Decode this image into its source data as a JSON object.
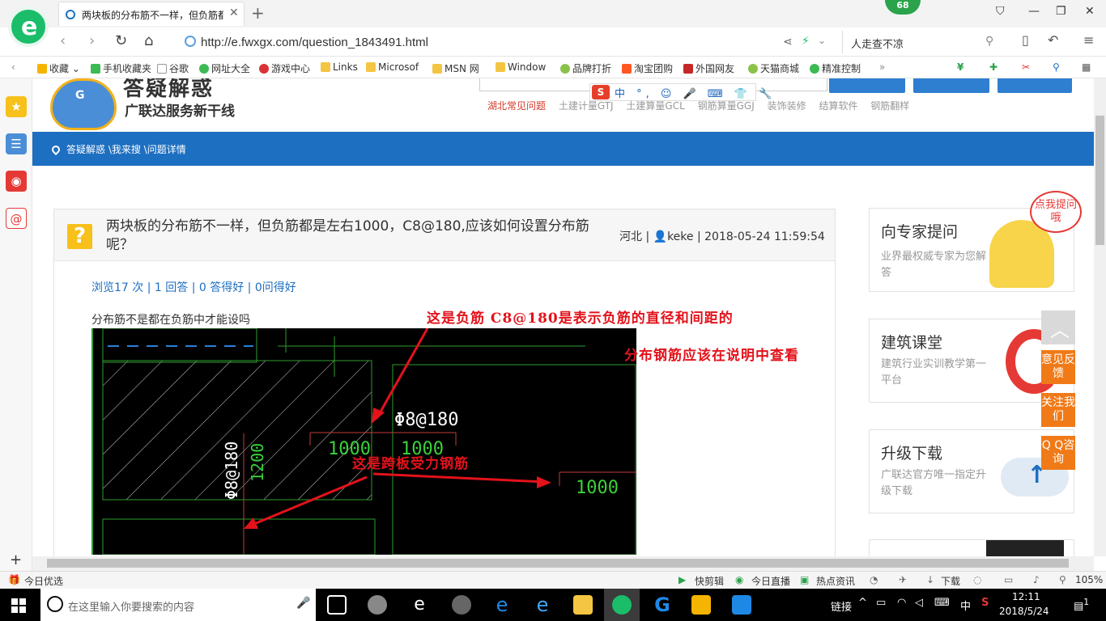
{
  "browser": {
    "tab_title": "两块板的分布筋不一样，但负筋都是左右1000，C8@180,应该如何设置分布筋呢？",
    "badge": "68",
    "url": "http://e.fwxgx.com/question_1843491.html",
    "search_query": "人走查不凉"
  },
  "bookmarks": [
    {
      "label": "收藏",
      "color": "#f4b400"
    },
    {
      "label": "手机收藏夹",
      "color": "#3cba54"
    },
    {
      "label": "谷歌",
      "color": "#ffffff"
    },
    {
      "label": "网址大全",
      "color": "#3cba54"
    },
    {
      "label": "游戏中心",
      "color": "#db3236"
    },
    {
      "label": "Links",
      "color": "#f4c542"
    },
    {
      "label": "Microsof",
      "color": "#f4c542"
    },
    {
      "label": "MSN 网",
      "color": "#f4c542"
    },
    {
      "label": "Window",
      "color": "#f4c542"
    },
    {
      "label": "品牌打折",
      "color": "#8bc34a"
    },
    {
      "label": "淘宝团购",
      "color": "#ff5722"
    },
    {
      "label": "外国网友",
      "color": "#c62828"
    },
    {
      "label": "天猫商城",
      "color": "#8bc34a"
    },
    {
      "label": "精准控制",
      "color": "#3cba54"
    }
  ],
  "site": {
    "logo_title": "答疑解惑",
    "logo_subtitle": "广联达服务新干线",
    "ime_items": "中 °, ☺ 🎤 ⌨ 👕 🔧",
    "hot_links": [
      "湖北常见问题",
      "土建计量GTJ",
      "土建算量GCL",
      "钢筋算量GGJ",
      "装饰装修",
      "结算软件",
      "钢筋翻样"
    ],
    "breadcrumb": "答疑解惑 \\我来搜 \\问题详情"
  },
  "question": {
    "title": "两块板的分布筋不一样，但负筋都是左右1000，C8@180,应该如何设置分布筋呢？",
    "region": "河北",
    "user": "keke",
    "datetime": "2018-05-24 11:59:54",
    "stats": "浏览17 次 | 1 回答 | 0 答得好 | 0问得好",
    "body": "分布筋不是都在负筋中才能设吗"
  },
  "annotations": {
    "a1": "这是负筋 C8@180是表示负筋的直径和间距的",
    "a2": "分布钢筋应该在说明中查看",
    "a3": "这是跨板受力钢筋"
  },
  "cad_labels": {
    "rebar1": "Φ8@180",
    "dim1": "1000",
    "dim2": "1000",
    "dim3": "1000",
    "rebar2": "Φ8@180",
    "dim4": "1200"
  },
  "right_cards": [
    {
      "title": "向专家提问",
      "desc": "业界最权威专家为您解答",
      "bubble": "点我提问哦"
    },
    {
      "title": "建筑课堂",
      "desc": "建筑行业实训教学第一平台"
    },
    {
      "title": "升级下载",
      "desc": "广联达官方唯一指定升级下载"
    }
  ],
  "float_buttons": [
    "意见反馈",
    "关注我们",
    "Q Q咨询"
  ],
  "statusbar": {
    "left": "今日优选",
    "items": [
      "快剪辑",
      "今日直播",
      "热点资讯",
      "下载"
    ],
    "zoom": "105%"
  },
  "taskbar": {
    "search_placeholder": "在这里输入你要搜索的内容",
    "tray_link": "链接",
    "ime": "中",
    "time": "12:11",
    "date": "2018/5/24",
    "notifications": "1"
  }
}
